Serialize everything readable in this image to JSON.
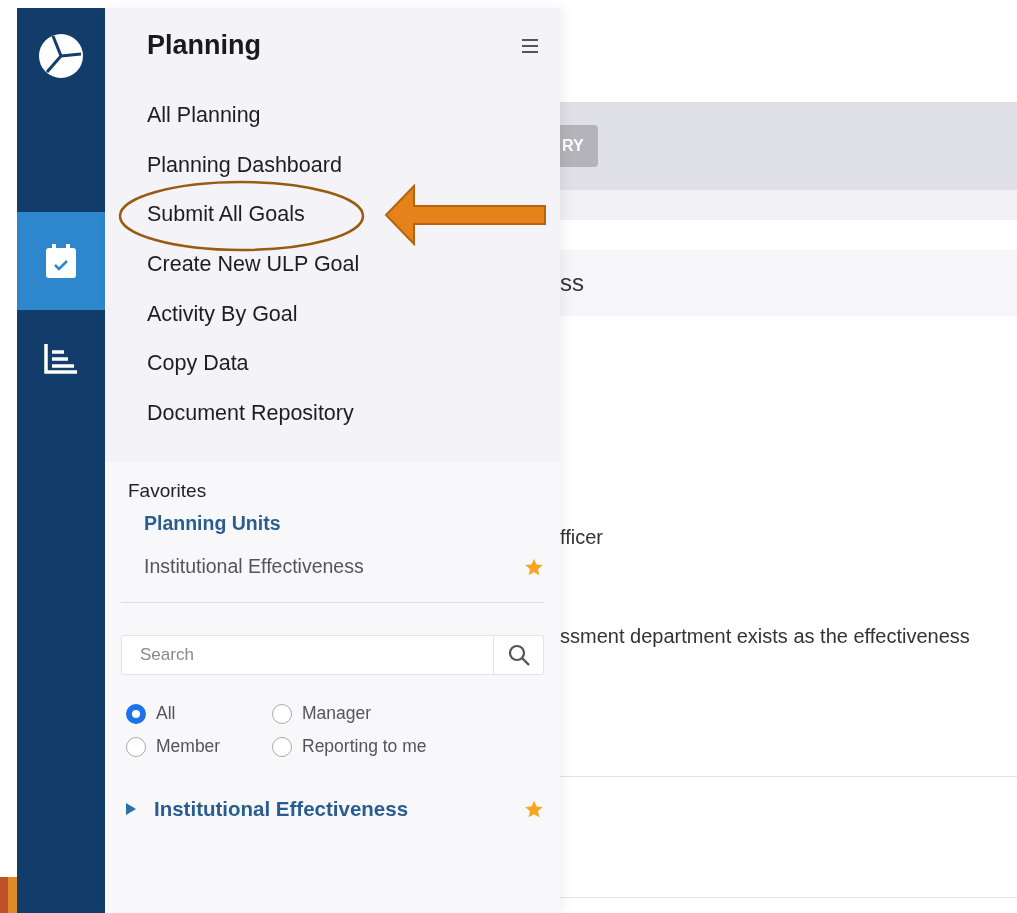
{
  "rail": {
    "items": [
      {
        "kind": "calendar",
        "selected": true
      },
      {
        "kind": "chart",
        "selected": false
      }
    ]
  },
  "panel": {
    "title": "Planning",
    "menu": [
      {
        "label": "All Planning"
      },
      {
        "label": "Planning Dashboard"
      },
      {
        "label": "Submit All Goals"
      },
      {
        "label": "Create New ULP Goal"
      },
      {
        "label": "Activity By Goal"
      },
      {
        "label": "Copy Data"
      },
      {
        "label": "Document Repository"
      }
    ],
    "favorites": {
      "title": "Favorites",
      "items": [
        {
          "label": "Planning Units",
          "kind": "link",
          "favorite": false
        },
        {
          "label": "Institutional Effectiveness",
          "kind": "plain",
          "favorite": true
        }
      ]
    },
    "search": {
      "placeholder": "Search"
    },
    "filters": [
      {
        "label": "All",
        "selected": true
      },
      {
        "label": "Manager",
        "selected": false
      },
      {
        "label": "Member",
        "selected": false
      },
      {
        "label": "Reporting to me",
        "selected": false
      }
    ],
    "tree": [
      {
        "label": "Institutional Effectiveness",
        "expanded": false,
        "favorite": true
      }
    ]
  },
  "content": {
    "button": "RY",
    "heading": "ss",
    "lines": [
      "fficer",
      "ssment department exists as the effectiveness"
    ]
  }
}
